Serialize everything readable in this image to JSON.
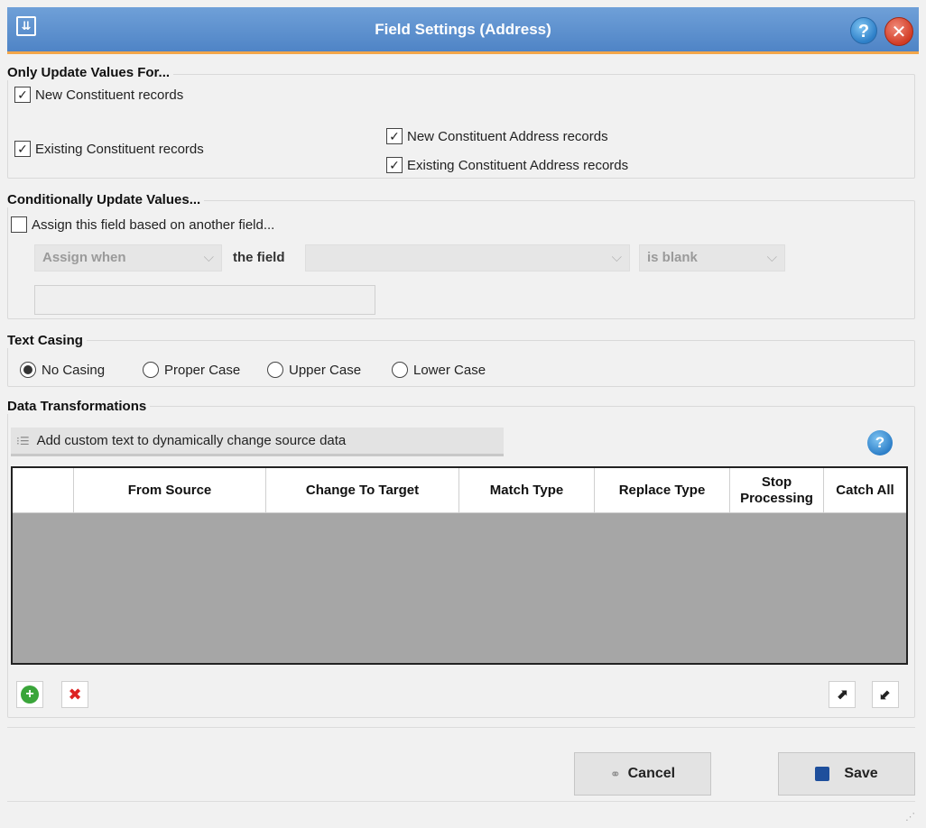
{
  "window": {
    "title": "Field Settings (Address)"
  },
  "update_for": {
    "title": "Only Update Values For...",
    "new_constituent": {
      "label": "New Constituent records",
      "checked": true
    },
    "existing_constituent": {
      "label": "Existing Constituent records",
      "checked": true
    },
    "new_address": {
      "label": "New Constituent Address records",
      "checked": true
    },
    "existing_address": {
      "label": "Existing Constituent Address records",
      "checked": true
    }
  },
  "conditional": {
    "title": "Conditionally Update Values...",
    "assign": {
      "label": "Assign this field based on another field...",
      "checked": false
    },
    "assign_when": "Assign when",
    "the_field_label": "the field",
    "field_value": "",
    "condition": "is blank",
    "value_text": ""
  },
  "text_casing": {
    "title": "Text Casing",
    "options": [
      "No Casing",
      "Proper Case",
      "Upper Case",
      "Lower Case"
    ],
    "selected": "No Casing"
  },
  "transformations": {
    "title": "Data Transformations",
    "add_custom_label": "Add custom text to dynamically change source data",
    "columns": [
      "",
      "From Source",
      "Change To Target",
      "Match Type",
      "Replace Type",
      "Stop Processing",
      "Catch All"
    ],
    "rows": []
  },
  "footer": {
    "cancel_label": "Cancel",
    "save_label": "Save"
  },
  "colors": {
    "title_bar": "#5a8fd0",
    "accent": "#f3a64a",
    "grid_empty": "#a6a6a6"
  }
}
